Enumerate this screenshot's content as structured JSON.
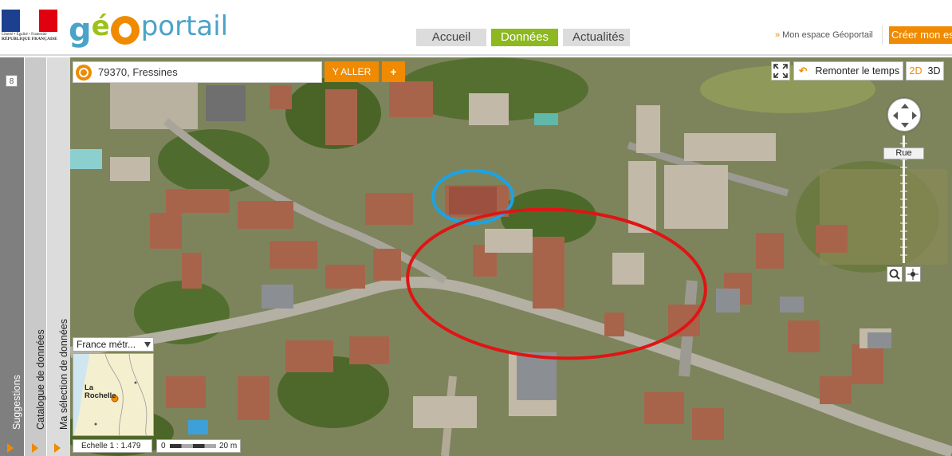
{
  "header": {
    "republic_motto": "Liberté • Égalité • Fraternité",
    "republic_name": "RÉPUBLIQUE FRANÇAISE",
    "logo_text_1": "g",
    "logo_text_2": "é",
    "logo_text_3": "portail",
    "nav_tabs": [
      {
        "label": "Accueil",
        "active": false
      },
      {
        "label": "Données",
        "active": true
      },
      {
        "label": "Actualités",
        "active": false
      }
    ],
    "espace_link": "Mon espace Géoportail",
    "create_button": "Créer mon es"
  },
  "sidebar": {
    "count_badge": "8",
    "panels": [
      {
        "label": "Suggestions"
      },
      {
        "label": "Catalogue de données"
      },
      {
        "label": "Ma sélection de données"
      }
    ]
  },
  "map": {
    "search": {
      "value": "79370, Fressines"
    },
    "go_button": "Y ALLER",
    "plus_button": "+",
    "time_button": "Remonter le temps",
    "dim_2d": "2D",
    "dim_3d": "3D",
    "zoom_level_label": "Rue",
    "minimap": {
      "region_select": "France métr...",
      "city_label": "La Rochelle"
    },
    "scale": {
      "ratio": "Echelle 1 : 1.479",
      "zero": "0",
      "distance": "20 m"
    }
  },
  "colors": {
    "accent": "#f08a00",
    "active_tab": "#8db820",
    "annotation_blue": "#1aa3e8",
    "annotation_red": "#e01414"
  }
}
